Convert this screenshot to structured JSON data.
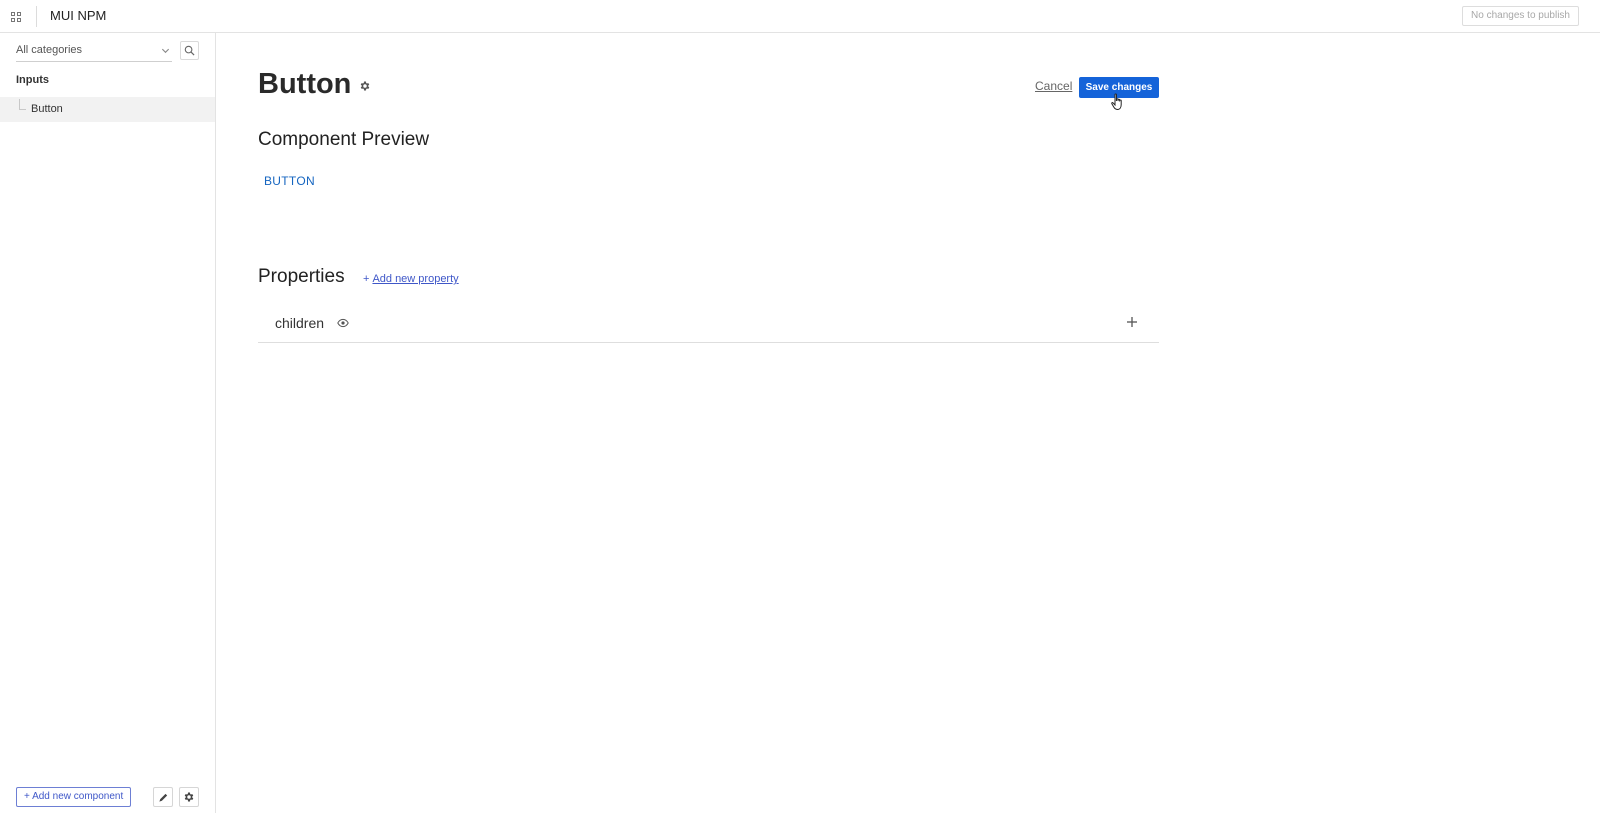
{
  "topbar": {
    "apps_icon": "grid-icon",
    "app_title": "MUI NPM",
    "publish_label": "No changes to publish"
  },
  "sidebar": {
    "category_select": {
      "selected": "All categories",
      "icon": "chevron-down-icon"
    },
    "search_icon": "search-icon",
    "category_heading": "Inputs",
    "items": [
      {
        "label": "Button",
        "selected": true
      }
    ],
    "add_component_label": "+ Add new component",
    "edit_icon": "pencil-icon",
    "settings_icon": "gear-icon"
  },
  "main": {
    "title": "Button",
    "title_icon": "gear-icon",
    "cancel_label": "Cancel",
    "save_label": "Save changes",
    "preview_heading": "Component Preview",
    "preview_button_label": "BUTTON",
    "properties_heading": "Properties",
    "add_property_plus": "+",
    "add_property_label": "Add new property",
    "properties": [
      {
        "name": "children",
        "icon": "eye-icon",
        "action_icon": "plus-icon"
      }
    ]
  },
  "colors": {
    "accent": "#1463d9",
    "link": "#3f57c8",
    "preview_text": "#1565c0",
    "selected_row": "#f2f2f2"
  }
}
